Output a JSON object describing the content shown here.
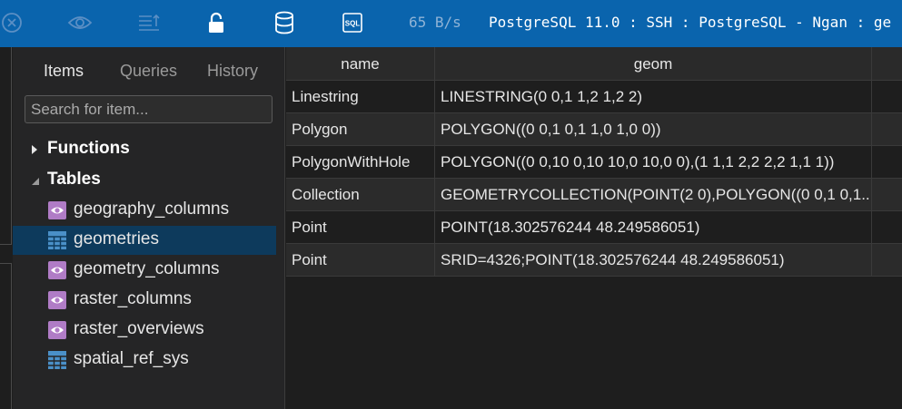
{
  "toolbar": {
    "icons": [
      "close-circle-icon",
      "eye-icon",
      "list-sort-icon",
      "lock-icon",
      "database-icon",
      "sql-file-icon"
    ],
    "sql_badge": "SQL",
    "speed": "65 B/s",
    "connection_title": "PostgreSQL 11.0 : SSH : PostgreSQL - Ngan : ge"
  },
  "sidebar": {
    "tabs": [
      {
        "label": "Items",
        "active": true
      },
      {
        "label": "Queries",
        "active": false
      },
      {
        "label": "History",
        "active": false
      }
    ],
    "search": {
      "placeholder": "Search for item...",
      "value": ""
    },
    "groups": [
      {
        "label": "Functions",
        "expanded": false
      },
      {
        "label": "Tables",
        "expanded": true
      }
    ],
    "items": [
      {
        "label": "geography_columns",
        "kind": "view",
        "icon": "view-eye-icon",
        "selected": false
      },
      {
        "label": "geometries",
        "kind": "table",
        "icon": "table-grid-icon",
        "selected": true
      },
      {
        "label": "geometry_columns",
        "kind": "view",
        "icon": "view-eye-icon",
        "selected": false
      },
      {
        "label": "raster_columns",
        "kind": "view",
        "icon": "view-eye-icon",
        "selected": false
      },
      {
        "label": "raster_overviews",
        "kind": "view",
        "icon": "view-eye-icon",
        "selected": false
      },
      {
        "label": "spatial_ref_sys",
        "kind": "table",
        "icon": "table-grid-icon",
        "selected": false
      }
    ]
  },
  "grid": {
    "columns": [
      "name",
      "geom"
    ],
    "rows": [
      {
        "name": "Linestring",
        "geom": "LINESTRING(0 0,1 1,2 1,2 2)"
      },
      {
        "name": "Polygon",
        "geom": "POLYGON((0 0,1 0,1 1,0 1,0 0))"
      },
      {
        "name": "PolygonWithHole",
        "geom": "POLYGON((0 0,10 0,10 10,0 10,0 0),(1 1,1 2,2 2,2 1,1 1))"
      },
      {
        "name": "Collection",
        "geom": "GEOMETRYCOLLECTION(POINT(2 0),POLYGON((0 0,1 0,1..."
      },
      {
        "name": "Point",
        "geom": "POINT(18.302576244 48.249586051)"
      },
      {
        "name": "Point",
        "geom": "SRID=4326;POINT(18.302576244 48.249586051)"
      }
    ]
  },
  "colors": {
    "toolbar_bg": "#0a64ad",
    "sidebar_bg": "#252526",
    "selected_bg": "#0d3a5c",
    "view_icon": "#b07cc6",
    "table_icon": "#4a90c8"
  }
}
